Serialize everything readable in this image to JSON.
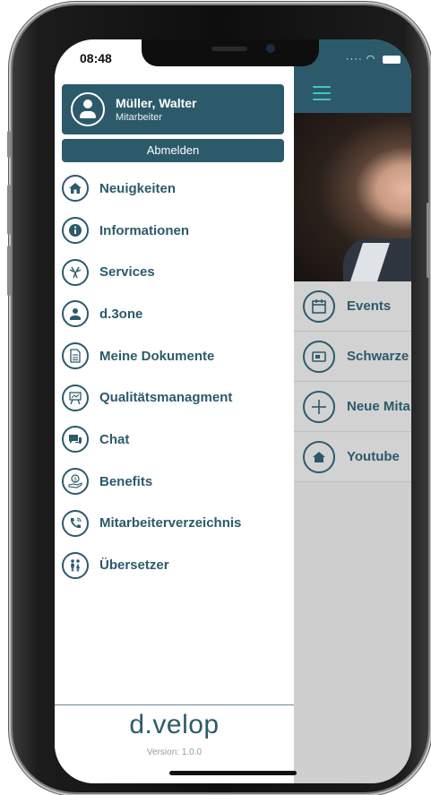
{
  "status_bar": {
    "time": "08:48"
  },
  "user": {
    "name": "Müller, Walter",
    "role": "Mitarbeiter"
  },
  "logout_label": "Abmelden",
  "menu": [
    {
      "label": "Neuigkeiten",
      "icon": "home-icon"
    },
    {
      "label": "Informationen",
      "icon": "info-icon"
    },
    {
      "label": "Services",
      "icon": "services-icon"
    },
    {
      "label": "d.3one",
      "icon": "d3one-icon"
    },
    {
      "label": "Meine Dokumente",
      "icon": "document-icon"
    },
    {
      "label": "Qualitätsmanagment",
      "icon": "presentation-icon"
    },
    {
      "label": "Chat",
      "icon": "chat-icon"
    },
    {
      "label": "Benefits",
      "icon": "benefits-icon"
    },
    {
      "label": "Mitarbeiterverzeichnis",
      "icon": "phone-icon"
    },
    {
      "label": "Übersetzer",
      "icon": "people-icon"
    }
  ],
  "footer": {
    "logo": "d.velop",
    "version": "Version: 1.0.0"
  },
  "background_app": {
    "items": [
      {
        "label": "Events",
        "icon": "calendar-icon"
      },
      {
        "label": "Schwarze",
        "icon": "newspaper-icon"
      },
      {
        "label": "Neue Mita",
        "icon": "plus-icon"
      },
      {
        "label": "Youtube",
        "icon": "home-icon"
      }
    ]
  },
  "colors": {
    "primary": "#2c5a6b",
    "accent": "#3ec9c0",
    "overlay": "#cfcfcf"
  }
}
